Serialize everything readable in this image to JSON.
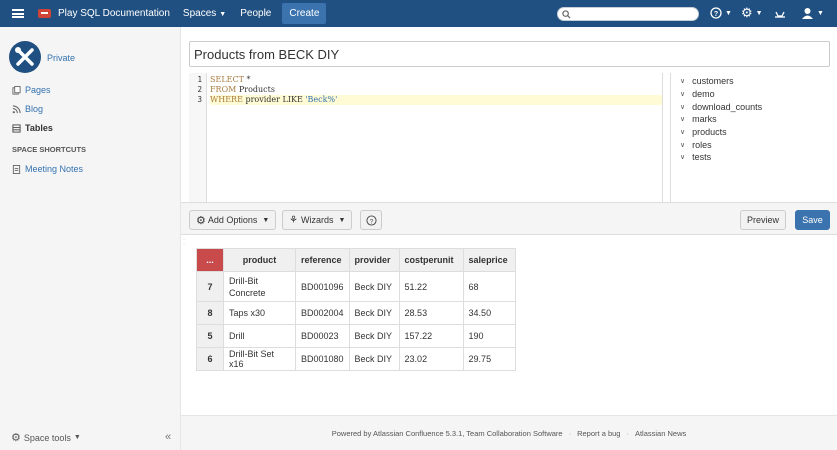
{
  "header": {
    "product_name": "Play SQL Documentation",
    "nav": {
      "spaces": "Spaces",
      "people": "People",
      "create": "Create"
    },
    "search_placeholder": ""
  },
  "sidebar": {
    "space_name": "Private",
    "items": [
      {
        "label": "Pages",
        "icon": "pages-icon"
      },
      {
        "label": "Blog",
        "icon": "blog-icon"
      },
      {
        "label": "Tables",
        "icon": "tables-icon",
        "active": true
      }
    ],
    "shortcuts_heading": "SPACE SHORTCUTS",
    "shortcuts": [
      {
        "label": "Meeting Notes",
        "icon": "document-icon"
      }
    ],
    "space_tools": "Space tools",
    "collapse": "«"
  },
  "editor": {
    "title": "Products from BECK DIY",
    "line_numbers": [
      "1",
      "2",
      "3"
    ],
    "lines": [
      {
        "kw": "SELECT",
        "rest": " *"
      },
      {
        "kw": "FROM",
        "rest": " Products"
      },
      {
        "kw": "WHERE",
        "rest": " provider LIKE ",
        "str": "'Beck%'"
      }
    ]
  },
  "tables_panel": [
    "customers",
    "demo",
    "download_counts",
    "marks",
    "products",
    "roles",
    "tests"
  ],
  "toolbar": {
    "add_options": "Add Options",
    "wizards": "Wizards",
    "help": "?",
    "preview": "Preview",
    "save": "Save"
  },
  "results": {
    "corner": "...",
    "columns": [
      "product",
      "reference",
      "provider",
      "costperunit",
      "saleprice"
    ],
    "rows": [
      {
        "id": "7",
        "cells": [
          "Drill-Bit Concrete",
          "BD001096",
          "Beck DIY",
          "51.22",
          "68"
        ]
      },
      {
        "id": "8",
        "cells": [
          "Taps x30",
          "BD002004",
          "Beck DIY",
          "28.53",
          "34.50"
        ]
      },
      {
        "id": "5",
        "cells": [
          "Drill",
          "BD00023",
          "Beck DIY",
          "157.22",
          "190"
        ]
      },
      {
        "id": "6",
        "cells": [
          "Drill-Bit Set x16",
          "BD001080",
          "Beck DIY",
          "23.02",
          "29.75"
        ]
      }
    ]
  },
  "footer": {
    "powered": "Powered by Atlassian Confluence 5.3.1, Team Collaboration Software",
    "report": "Report a bug",
    "news": "Atlassian News"
  },
  "colors": {
    "header": "#205081",
    "accent": "#3b73af",
    "corner": "#c94a4a",
    "highlight": "#fffbd4"
  }
}
